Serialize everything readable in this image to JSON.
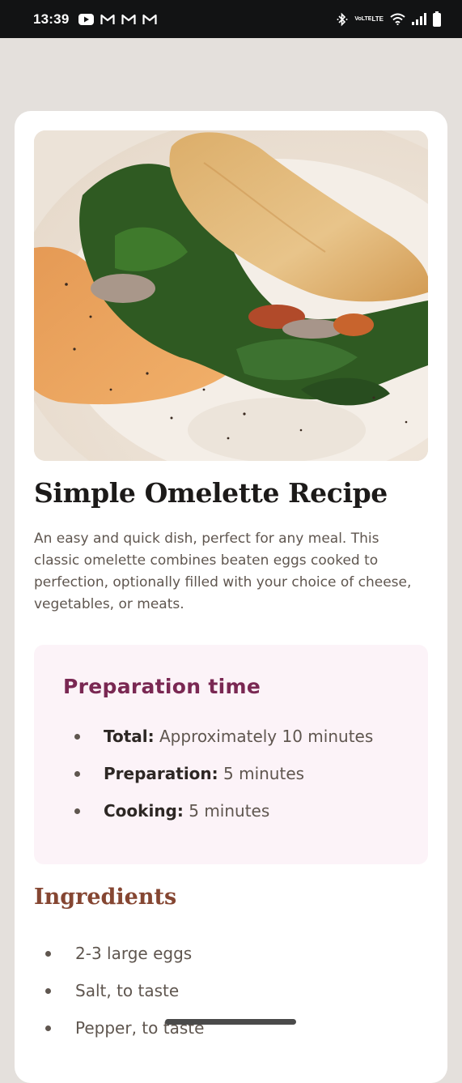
{
  "status_bar": {
    "time": "13:39",
    "notification_icons": [
      "youtube-icon",
      "gmail-icon",
      "gmail-icon",
      "gmail-icon"
    ],
    "system_icons": [
      "bluetooth-icon",
      "volte-icon",
      "wifi-icon",
      "signal-icon",
      "battery-icon"
    ],
    "volte_line1": "VoLTE",
    "volte_line2": "LTE"
  },
  "recipe": {
    "image_alt": "omelette-with-spinach-photo",
    "title": "Simple Omelette Recipe",
    "intro": "An easy and quick dish, perfect for any meal. This classic omelette combines beaten eggs cooked to perfection, optionally filled with your choice of cheese, vegetables, or meats.",
    "preparation": {
      "heading": "Preparation time",
      "items": [
        {
          "label": "Total:",
          "value": " Approximately 10 minutes"
        },
        {
          "label": "Preparation:",
          "value": " 5 minutes"
        },
        {
          "label": "Cooking:",
          "value": " 5 minutes"
        }
      ]
    },
    "ingredients": {
      "heading": "Ingredients",
      "items": [
        "2-3 large eggs",
        "Salt, to taste",
        "Pepper, to taste"
      ]
    }
  },
  "colors": {
    "background": "#e4e0dc",
    "card": "#ffffff",
    "prep_box": "#fcf3f8",
    "prep_heading": "#7a2853",
    "ingredients_heading": "#854632",
    "body_text": "#5f564f",
    "title_text": "#1c1a19"
  }
}
